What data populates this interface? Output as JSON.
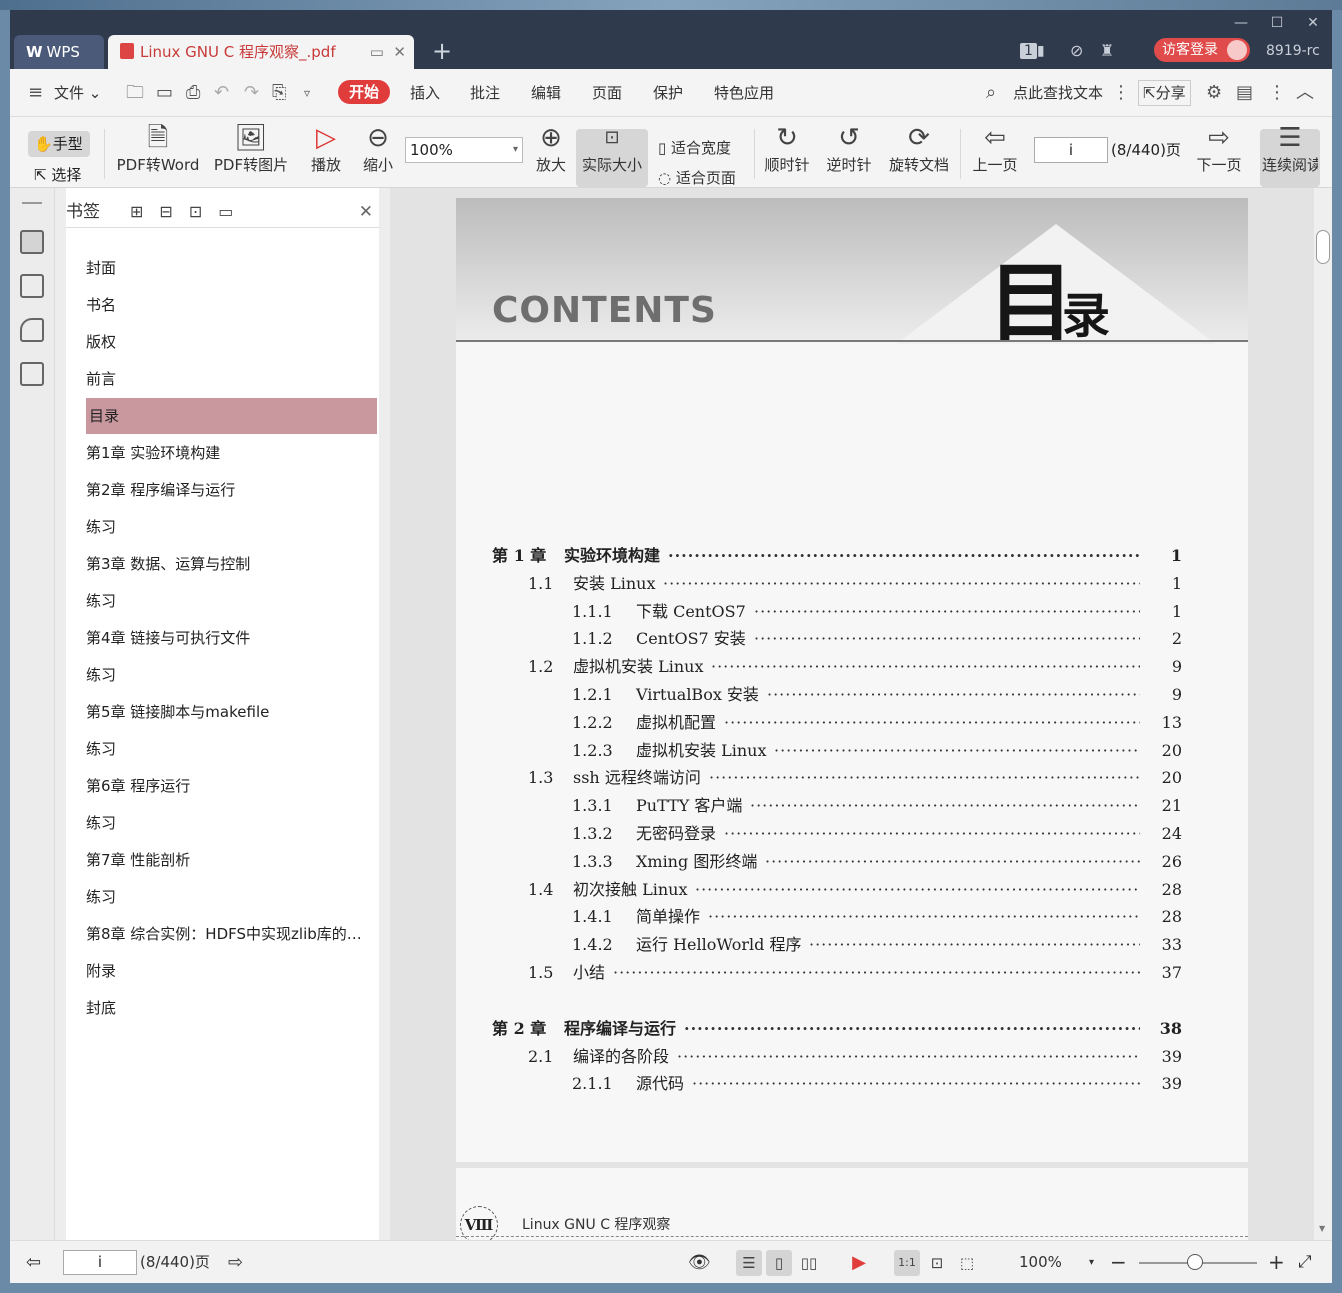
{
  "titlebar": {
    "app_tab": "WPS",
    "doc_tab": "Linux GNU C 程序观察_.pdf",
    "tab_count": "1",
    "login_label": "访客登录",
    "version": "8919-rc"
  },
  "menubar": {
    "file": "文件",
    "items": [
      "开始",
      "插入",
      "批注",
      "编辑",
      "页面",
      "保护",
      "特色应用"
    ],
    "search_label": "点此查找文本",
    "share": "分享"
  },
  "toolbar": {
    "hand": "手型",
    "select": "选择",
    "pdf_to_word": "PDF转Word",
    "pdf_to_image": "PDF转图片",
    "play": "播放",
    "zoom_out": "缩小",
    "zoom_value": "100%",
    "zoom_in": "放大",
    "actual_size": "实际大小",
    "fit_width": "适合宽度",
    "fit_page": "适合页面",
    "rotate_cw": "顺时针",
    "rotate_ccw": "逆时针",
    "rotate_doc": "旋转文档",
    "prev_page": "上一页",
    "page_input": "i",
    "page_total": "(8/440)页",
    "next_page": "下一页",
    "continuous": "连续阅读"
  },
  "bookmarks": {
    "title": "书签",
    "items": [
      {
        "label": "封面",
        "expandable": false,
        "active": false
      },
      {
        "label": "书名",
        "expandable": false,
        "active": false
      },
      {
        "label": "版权",
        "expandable": false,
        "active": false
      },
      {
        "label": "前言",
        "expandable": false,
        "active": false
      },
      {
        "label": "目录",
        "expandable": false,
        "active": true
      },
      {
        "label": "第1章 实验环境构建",
        "expandable": true,
        "active": false
      },
      {
        "label": "第2章 程序编译与运行",
        "expandable": true,
        "active": false
      },
      {
        "label": "练习",
        "expandable": false,
        "active": false
      },
      {
        "label": "第3章 数据、运算与控制",
        "expandable": true,
        "active": false
      },
      {
        "label": "练习",
        "expandable": false,
        "active": false
      },
      {
        "label": "第4章 链接与可执行文件",
        "expandable": true,
        "active": false
      },
      {
        "label": "练习",
        "expandable": false,
        "active": false
      },
      {
        "label": "第5章 链接脚本与makefile",
        "expandable": true,
        "active": false
      },
      {
        "label": "练习",
        "expandable": false,
        "active": false
      },
      {
        "label": "第6章 程序运行",
        "expandable": true,
        "active": false
      },
      {
        "label": "练习",
        "expandable": false,
        "active": false
      },
      {
        "label": "第7章 性能剖析",
        "expandable": true,
        "active": false
      },
      {
        "label": "练习",
        "expandable": false,
        "active": false
      },
      {
        "label": "第8章 综合实例：HDFS中实现zlib库的旁...",
        "expandable": true,
        "active": false
      },
      {
        "label": "附录",
        "expandable": false,
        "active": false
      },
      {
        "label": "封底",
        "expandable": false,
        "active": false
      }
    ]
  },
  "page": {
    "contents_word": "CONTENTS",
    "title_big": "目",
    "title_small": "录",
    "toc": [
      {
        "level": 0,
        "num": "第 1 章",
        "title": "实验环境构建",
        "page": "1"
      },
      {
        "level": 1,
        "num": "1.1",
        "title": "安装 Linux",
        "page": "1"
      },
      {
        "level": 2,
        "num": "1.1.1",
        "title": "下载 CentOS7",
        "page": "1"
      },
      {
        "level": 2,
        "num": "1.1.2",
        "title": "CentOS7 安装",
        "page": "2"
      },
      {
        "level": 1,
        "num": "1.2",
        "title": "虚拟机安装 Linux",
        "page": "9"
      },
      {
        "level": 2,
        "num": "1.2.1",
        "title": "VirtualBox 安装",
        "page": "9"
      },
      {
        "level": 2,
        "num": "1.2.2",
        "title": "虚拟机配置",
        "page": "13"
      },
      {
        "level": 2,
        "num": "1.2.3",
        "title": "虚拟机安装 Linux",
        "page": "20"
      },
      {
        "level": 1,
        "num": "1.3",
        "title": "ssh 远程终端访问",
        "page": "20"
      },
      {
        "level": 2,
        "num": "1.3.1",
        "title": "PuTTY 客户端",
        "page": "21"
      },
      {
        "level": 2,
        "num": "1.3.2",
        "title": "无密码登录",
        "page": "24"
      },
      {
        "level": 2,
        "num": "1.3.3",
        "title": "Xming 图形终端",
        "page": "26"
      },
      {
        "level": 1,
        "num": "1.4",
        "title": "初次接触 Linux",
        "page": "28"
      },
      {
        "level": 2,
        "num": "1.4.1",
        "title": "简单操作",
        "page": "28"
      },
      {
        "level": 2,
        "num": "1.4.2",
        "title": "运行 HelloWorld 程序",
        "page": "33"
      },
      {
        "level": 1,
        "num": "1.5",
        "title": "小结",
        "page": "37"
      },
      {
        "level": 0,
        "num": "第 2 章",
        "title": "程序编译与运行",
        "page": "38"
      },
      {
        "level": 1,
        "num": "2.1",
        "title": "编译的各阶段",
        "page": "39"
      },
      {
        "level": 2,
        "num": "2.1.1",
        "title": "源代码",
        "page": "39"
      }
    ]
  },
  "page2": {
    "roman": "Ⅷ",
    "header": "Linux GNU C 程序观察"
  },
  "statusbar": {
    "page_input": "i",
    "page_total": "(8/440)页",
    "zoom": "100%"
  },
  "colors": {
    "accent": "#e03c3c",
    "active_bookmark": "#c9979e",
    "titlebar": "#2f3a4c"
  }
}
